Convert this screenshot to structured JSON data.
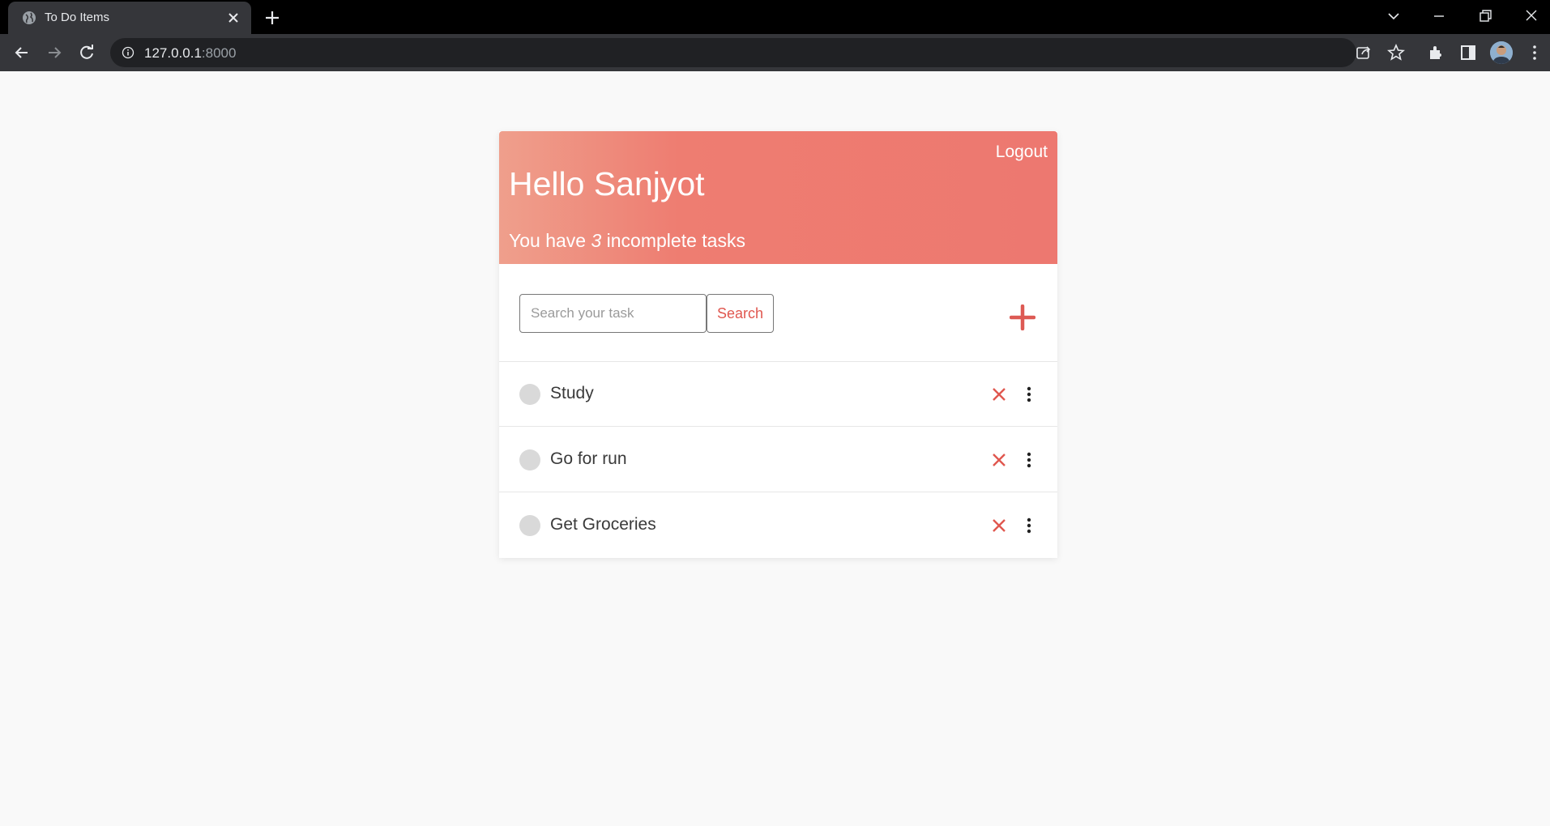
{
  "browser": {
    "tab_title": "To Do Items",
    "url_host": "127.0.0.1",
    "url_port": ":8000"
  },
  "app": {
    "logout_label": "Logout",
    "greeting": "Hello Sanjyot",
    "incomplete_prefix": "You have ",
    "incomplete_count": "3",
    "incomplete_suffix": " incomplete tasks",
    "search": {
      "placeholder": "Search your task",
      "button_label": "Search"
    },
    "tasks": [
      {
        "label": "Study",
        "completed": false
      },
      {
        "label": "Go for run",
        "completed": false
      },
      {
        "label": "Get Groceries",
        "completed": false
      }
    ],
    "colors": {
      "accent": "#ed7870",
      "accent_light": "#ef9f8c",
      "delete": "#e0574f",
      "check": "#d9d9d9"
    }
  },
  "icons": {
    "tab": "globe-icon",
    "add": "plus-icon",
    "delete": "close-icon",
    "more": "more-vertical-icon"
  }
}
